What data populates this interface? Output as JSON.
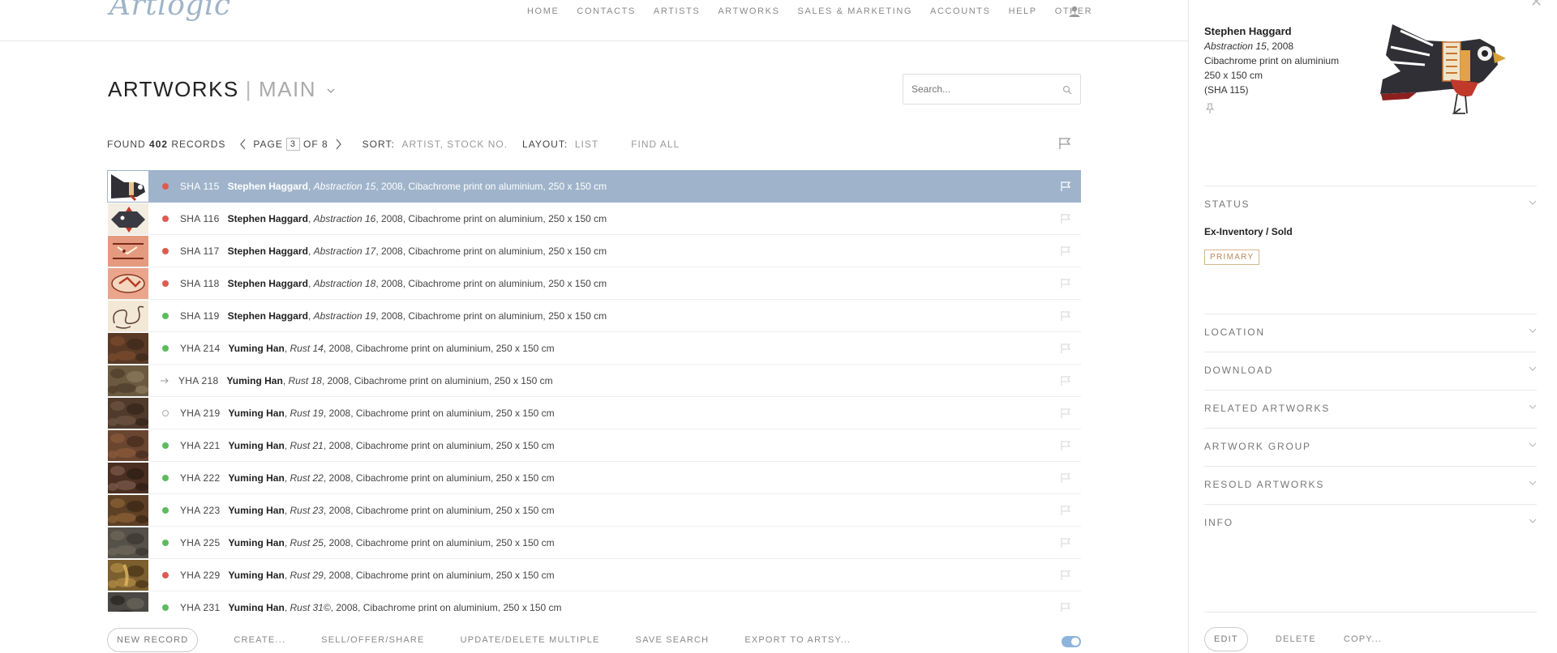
{
  "app": {
    "logo": "Artlogic"
  },
  "nav": [
    "HOME",
    "CONTACTS",
    "ARTISTS",
    "ARTWORKS",
    "SALES & MARKETING",
    "ACCOUNTS",
    "HELP",
    "OTHER"
  ],
  "header": {
    "title": "ARTWORKS",
    "view": "MAIN",
    "search_placeholder": "Search..."
  },
  "toolbar": {
    "found_label": "FOUND",
    "count": "402",
    "records_label": "RECORDS",
    "page_label": "PAGE",
    "page": "3",
    "of_label": "OF 8",
    "sort_label": "SORT:",
    "sort_value": "ARTIST, STOCK NO.",
    "layout_label": "LAYOUT:",
    "layout_value": "LIST",
    "find_all": "FIND ALL"
  },
  "rows": [
    {
      "stock": "SHA 115",
      "artist": "Stephen Haggard",
      "title": "Abstraction 15",
      "details": ", 2008, Cibachrome print on aluminium, 250 x 150 cm",
      "status": "red",
      "selected": true,
      "thumb": "bird"
    },
    {
      "stock": "SHA 116",
      "artist": "Stephen Haggard",
      "title": "Abstraction 16",
      "details": ", 2008, Cibachrome print on aluminium, 250 x 150 cm",
      "status": "red",
      "selected": false,
      "thumb": "fish"
    },
    {
      "stock": "SHA 117",
      "artist": "Stephen Haggard",
      "title": "Abstraction 17",
      "details": ", 2008, Cibachrome print on aluminium, 250 x 150 cm",
      "status": "red",
      "selected": false,
      "thumb": "salmon"
    },
    {
      "stock": "SHA 118",
      "artist": "Stephen Haggard",
      "title": "Abstraction 18",
      "details": ", 2008, Cibachrome print on aluminium, 250 x 150 cm",
      "status": "red",
      "selected": false,
      "thumb": "salmon2"
    },
    {
      "stock": "SHA 119",
      "artist": "Stephen Haggard",
      "title": "Abstraction 19",
      "details": ", 2008, Cibachrome print on aluminium, 250 x 150 cm",
      "status": "green",
      "selected": false,
      "thumb": "swirl"
    },
    {
      "stock": "YHA 214",
      "artist": "Yuming Han",
      "title": "Rust 14",
      "details": ", 2008, Cibachrome print on aluminium, 250 x 150 cm",
      "status": "green",
      "selected": false,
      "thumb": "rust1"
    },
    {
      "stock": "YHA 218",
      "artist": "Yuming Han",
      "title": "Rust 18",
      "details": ", 2008, Cibachrome print on aluminium, 250 x 150 cm",
      "status": "arrow",
      "selected": false,
      "thumb": "rust2"
    },
    {
      "stock": "YHA 219",
      "artist": "Yuming Han",
      "title": "Rust 19",
      "details": ", 2008, Cibachrome print on aluminium, 250 x 150 cm",
      "status": "empty",
      "selected": false,
      "thumb": "rust3"
    },
    {
      "stock": "YHA 221",
      "artist": "Yuming Han",
      "title": "Rust 21",
      "details": ", 2008, Cibachrome print on aluminium, 250 x 150 cm",
      "status": "green",
      "selected": false,
      "thumb": "rust4"
    },
    {
      "stock": "YHA 222",
      "artist": "Yuming Han",
      "title": "Rust 22",
      "details": ", 2008, Cibachrome print on aluminium, 250 x 150 cm",
      "status": "green",
      "selected": false,
      "thumb": "rust5"
    },
    {
      "stock": "YHA 223",
      "artist": "Yuming Han",
      "title": "Rust 23",
      "details": ", 2008, Cibachrome print on aluminium, 250 x 150 cm",
      "status": "green",
      "selected": false,
      "thumb": "rust6"
    },
    {
      "stock": "YHA 225",
      "artist": "Yuming Han",
      "title": "Rust 25",
      "details": ", 2008, Cibachrome print on aluminium, 250 x 150 cm",
      "status": "green",
      "selected": false,
      "thumb": "rust7"
    },
    {
      "stock": "YHA 229",
      "artist": "Yuming Han",
      "title": "Rust 29",
      "details": ", 2008, Cibachrome print on aluminium, 250 x 150 cm",
      "status": "red",
      "selected": false,
      "thumb": "rust8"
    },
    {
      "stock": "YHA 231",
      "artist": "Yuming Han",
      "title": "Rust 31©",
      "details": ", 2008, Cibachrome print on aluminium, 250 x 150 cm",
      "status": "green",
      "selected": false,
      "thumb": "rust9"
    }
  ],
  "bottombar": {
    "new_record": "NEW RECORD",
    "create": "CREATE...",
    "sell": "SELL/OFFER/SHARE",
    "update": "UPDATE/DELETE MULTIPLE",
    "save_search": "SAVE SEARCH",
    "export": "EXPORT TO ARTSY..."
  },
  "panel": {
    "artist": "Stephen Haggard",
    "title": "Abstraction 15",
    "year": ", 2008",
    "medium": "Cibachrome print on aluminium",
    "dimensions": "250 x 150 cm",
    "stock": "(SHA 115)",
    "sections": {
      "status": "STATUS",
      "location": "LOCATION",
      "download": "DOWNLOAD",
      "related": "RELATED ARTWORKS",
      "group": "ARTWORK GROUP",
      "resold": "RESOLD ARTWORKS",
      "info": "INFO"
    },
    "status_value": "Ex-Inventory / Sold",
    "badge": "PRIMARY",
    "edit": "EDIT",
    "delete": "DELETE",
    "copy": "COPY..."
  },
  "colors": {
    "selected_row": "#9fb4cb",
    "status_red": "#e05b4f",
    "status_green": "#5cbc5c",
    "badge_accent": "#b8895a"
  },
  "icons": [
    "user-icon",
    "search-icon",
    "chevron-left-icon",
    "chevron-right-icon",
    "flag-icon",
    "pin-icon",
    "chevron-down-icon",
    "close-icon",
    "toggle-switch"
  ]
}
